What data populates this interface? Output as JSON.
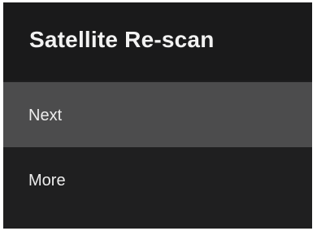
{
  "dialog": {
    "title": "Satellite Re-scan"
  },
  "menu": {
    "items": [
      {
        "label": "Next",
        "selected": true
      },
      {
        "label": "More",
        "selected": false
      }
    ]
  },
  "colors": {
    "background": "#1f1f20",
    "header_background": "#1a1a1b",
    "selected_item_background": "#4c4c4d",
    "text": "#f2f2f2"
  }
}
